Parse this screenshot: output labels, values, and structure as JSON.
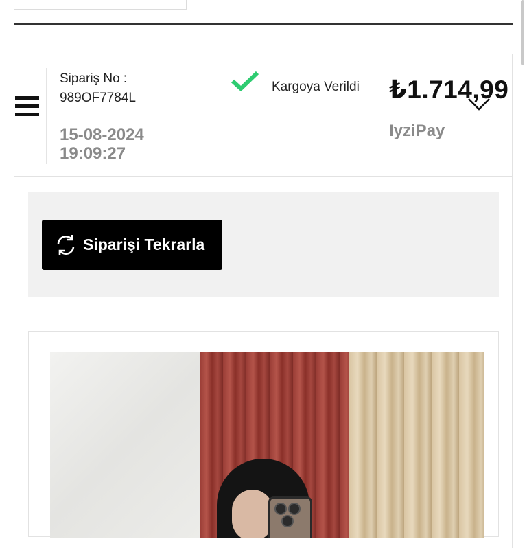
{
  "order": {
    "label": "Sipariş No :",
    "number": "989OF7784L",
    "date": "15-08-2024",
    "time": "19:09:27",
    "status": "Kargoya Verildi",
    "status_color": "#2ecc71",
    "price": "₺1.714,99",
    "payment_method": "IyziPay"
  },
  "actions": {
    "reorder_label": "Siparişi Tekrarla"
  },
  "icons": {
    "menu": "menu-icon",
    "status": "check-icon",
    "expand": "chevron-down-icon",
    "reorder": "refresh-icon"
  }
}
